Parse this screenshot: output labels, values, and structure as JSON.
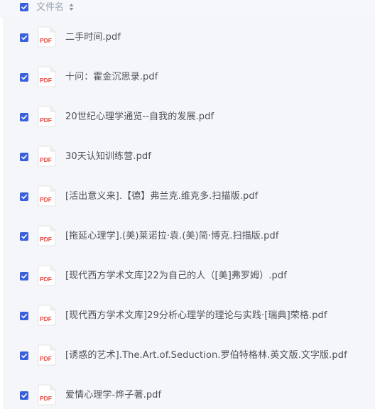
{
  "header": {
    "column_label": "文件名",
    "select_all_checked": true
  },
  "files": [
    {
      "name": "二手时间.pdf",
      "icon": "pdf-file-icon",
      "checked": true
    },
    {
      "name": "十问：霍金沉思录.pdf",
      "icon": "pdf-file-icon",
      "checked": true
    },
    {
      "name": "20世纪心理学通览--自我的发展.pdf",
      "icon": "pdf-file-icon",
      "checked": true
    },
    {
      "name": "30天认知训练营.pdf",
      "icon": "pdf-file-icon",
      "checked": true
    },
    {
      "name": "[活出意义来].【德】弗兰克.维克多.扫描版.pdf",
      "icon": "pdf-file-icon",
      "checked": true
    },
    {
      "name": "[拖延心理学].(美)莱诺拉·袁.(美)简·博克.扫描版.pdf",
      "icon": "pdf-file-icon",
      "checked": true
    },
    {
      "name": "[现代西方学术文库]22为自己的人（[美]弗罗姆）.pdf",
      "icon": "pdf-file-icon",
      "checked": true
    },
    {
      "name": "[现代西方学术文库]29分析心理学的理论与实践·[瑞典]荣格.pdf",
      "icon": "pdf-file-icon",
      "checked": true
    },
    {
      "name": "[诱惑的艺术].The.Art.of.Seduction.罗伯特格林.英文版.文字版.pdf",
      "icon": "pdf-file-icon",
      "checked": true
    },
    {
      "name": "爱情心理学-烨子著.pdf",
      "icon": "pdf-file-icon",
      "checked": true
    }
  ],
  "colors": {
    "checkbox": "#3a5fdc",
    "pdf_red": "#e8483f",
    "text": "#4b5058",
    "header_text": "#9aa3b2"
  }
}
